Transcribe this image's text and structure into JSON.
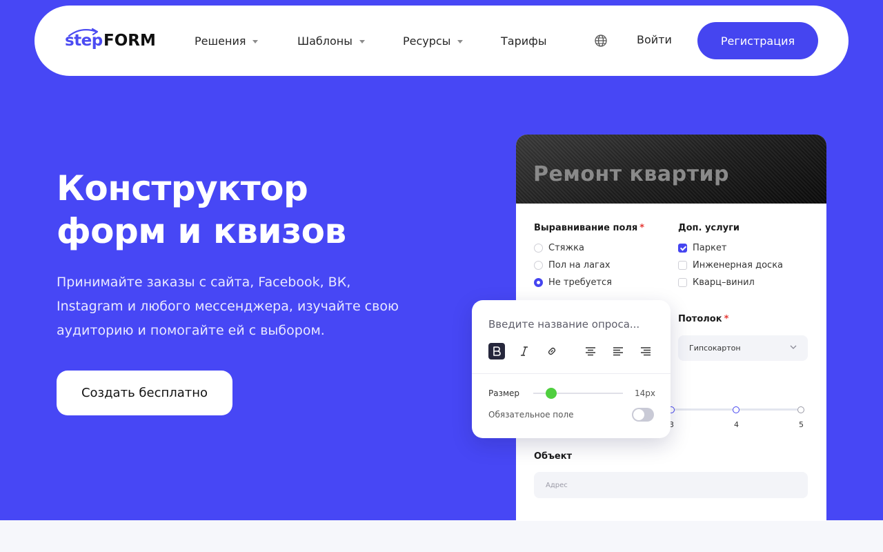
{
  "nav": {
    "logo_step": "step",
    "logo_form": "FORM",
    "items": [
      {
        "label": "Решения",
        "has_dropdown": true
      },
      {
        "label": "Шаблоны",
        "has_dropdown": true
      },
      {
        "label": "Ресурсы",
        "has_dropdown": true
      },
      {
        "label": "Тарифы",
        "has_dropdown": false
      }
    ],
    "language_icon": "globe-icon",
    "login_label": "Войти",
    "signup_label": "Регистрация"
  },
  "hero": {
    "title_line1": "Конструктор",
    "title_line2": "форм и квизов",
    "subtitle_line1": "Принимайте заказы с сайта, Facebook, ВК,",
    "subtitle_line2": "Instagram и любого мессенджера, изучайте свою",
    "subtitle_line3": "аудиторию и помогайте ей с выбором.",
    "cta_label": "Создать бесплатно"
  },
  "form_card": {
    "banner_title": "Ремонт квартир",
    "alignment": {
      "label": "Выравнивание поля",
      "required_mark": "*",
      "options": [
        {
          "label": "Стяжка",
          "selected": false
        },
        {
          "label": "Пол на лагах",
          "selected": false
        },
        {
          "label": "Не требуется",
          "selected": true
        }
      ]
    },
    "extras": {
      "label": "Доп. услуги",
      "options": [
        {
          "label": "Паркет",
          "checked": true
        },
        {
          "label": "Инженерная доска",
          "checked": false
        },
        {
          "label": "Кварц–винил",
          "checked": false
        }
      ]
    },
    "ceiling": {
      "label": "Потолок",
      "required_mark": "*",
      "selected_value": "Гипсокартон"
    },
    "scale": {
      "visible_labels": [
        "3",
        "4",
        "5"
      ]
    },
    "object": {
      "label": "Объект",
      "placeholder": "Адрес"
    }
  },
  "editor": {
    "placeholder": "Введите название опроса...",
    "toolbar": [
      "bold-icon",
      "italic-icon",
      "link-icon",
      "align-center-icon",
      "align-left-icon",
      "align-right-icon"
    ],
    "size_label": "Размер",
    "size_value": "14px",
    "size_fraction": 0.2,
    "required_label": "Обязательное поле",
    "required_on": false
  },
  "colors": {
    "brand": "#4747f5",
    "button": "#4545f0",
    "slider_knob": "#4fcf3f"
  }
}
